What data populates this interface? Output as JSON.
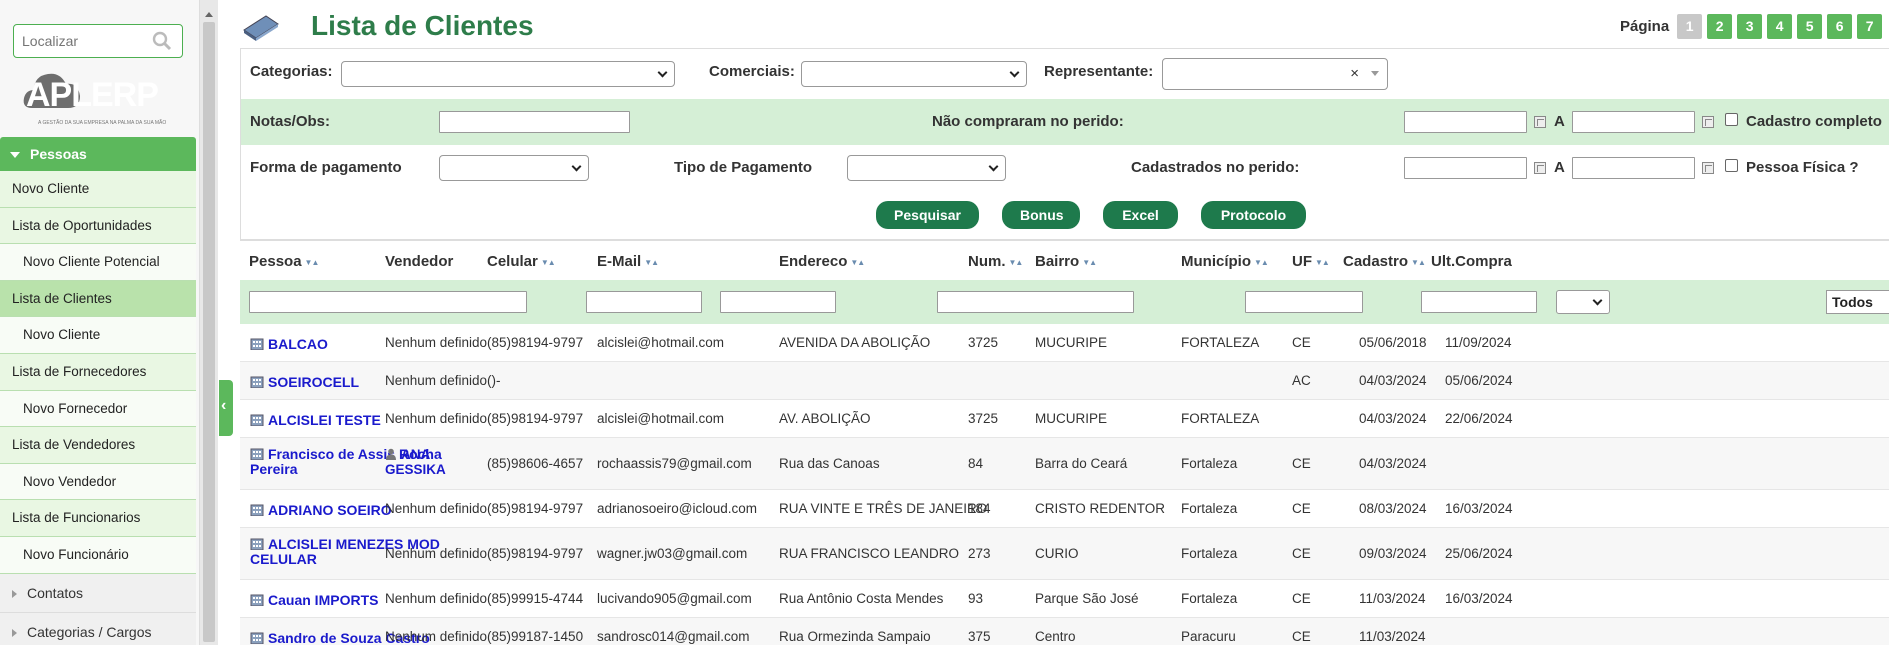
{
  "search": {
    "placeholder": "Localizar"
  },
  "logo": {
    "text": "APLERP",
    "tagline": "A GESTÃO DA SUA EMPRESA NA PALMA DA SUA MÃO"
  },
  "sidebar": {
    "section": "Pessoas",
    "items": [
      {
        "label": "Novo Cliente",
        "sub": false,
        "active": false
      },
      {
        "label": "Lista de Oportunidades",
        "sub": false,
        "active": false
      },
      {
        "label": "Novo Cliente Potencial",
        "sub": true,
        "active": false
      },
      {
        "label": "Lista de Clientes",
        "sub": false,
        "active": true
      },
      {
        "label": "Novo Cliente",
        "sub": true,
        "active": false
      },
      {
        "label": "Lista de Fornecedores",
        "sub": false,
        "active": false
      },
      {
        "label": "Novo Fornecedor",
        "sub": true,
        "active": false
      },
      {
        "label": "Lista de Vendedores",
        "sub": false,
        "active": false
      },
      {
        "label": "Novo Vendedor",
        "sub": true,
        "active": false
      },
      {
        "label": "Lista de Funcionarios",
        "sub": false,
        "active": false
      },
      {
        "label": "Novo Funcionário",
        "sub": true,
        "active": false
      }
    ],
    "collapsed": [
      "Contatos",
      "Categorias / Cargos"
    ]
  },
  "header": {
    "title": "Lista de Clientes",
    "pager_label": "Página",
    "pages": [
      "1",
      "2",
      "3",
      "4",
      "5",
      "6",
      "7"
    ],
    "current_page": "1"
  },
  "filters": {
    "categorias_label": "Categorias:",
    "comerciais_label": "Comerciais:",
    "representante_label": "Representante:",
    "representante_clear": "×",
    "notas_label": "Notas/Obs:",
    "nao_compraram_label": "Não compraram no perido:",
    "a_label": "A",
    "cadastro_completo_label": "Cadastro completo",
    "forma_pagamento_label": "Forma de pagamento",
    "tipo_pagamento_label": "Tipo de Pagamento",
    "cadastrados_label": "Cadastrados no perido:",
    "pessoa_fisica_label": "Pessoa Física ?"
  },
  "actions": {
    "pesquisar": "Pesquisar",
    "bonus": "Bonus",
    "excel": "Excel",
    "protocolo": "Protocolo"
  },
  "table": {
    "columns": [
      "Pessoa",
      "Vendedor",
      "Celular",
      "E-Mail",
      "Endereco",
      "Num.",
      "Bairro",
      "Município",
      "UF",
      "Cadastro",
      "Ult.Compra"
    ],
    "ult_compra_filter": "Todos",
    "rows": [
      {
        "pessoa": "BALCAO",
        "vendedor": "Nenhum definido",
        "vendedor_link": false,
        "celular": "(85)98194-9797",
        "email": "alcislei@hotmail.com",
        "endereco": "AVENIDA DA ABOLIÇÃO",
        "num": "3725",
        "bairro": "MUCURIPE",
        "municipio": "FORTALEZA",
        "uf": "CE",
        "cadastro": "05/06/2018",
        "ult_compra": "11/09/2024"
      },
      {
        "pessoa": "SOEIROCELL",
        "vendedor": "Nenhum definido",
        "vendedor_link": false,
        "celular": "()-",
        "email": "",
        "endereco": "",
        "num": "",
        "bairro": "",
        "municipio": "",
        "uf": "AC",
        "cadastro": "04/03/2024",
        "ult_compra": "05/06/2024"
      },
      {
        "pessoa": "ALCISLEI TESTE",
        "vendedor": "Nenhum definido",
        "vendedor_link": false,
        "celular": "(85)98194-9797",
        "email": "alcislei@hotmail.com",
        "endereco": "AV. ABOLIÇÃO",
        "num": "3725",
        "bairro": "MUCURIPE",
        "municipio": "FORTALEZA",
        "uf": "",
        "cadastro": "04/03/2024",
        "ult_compra": "22/06/2024"
      },
      {
        "pessoa": "Francisco de Assis Rocha Pereira",
        "vendedor": "ANA GESSIKA",
        "vendedor_link": true,
        "celular": "(85)98606-4657",
        "email": "rochaassis79@gmail.com",
        "endereco": "Rua das Canoas",
        "num": "84",
        "bairro": "Barra do Ceará",
        "municipio": "Fortaleza",
        "uf": "CE",
        "cadastro": "04/03/2024",
        "ult_compra": ""
      },
      {
        "pessoa": "ADRIANO SOEIRO",
        "vendedor": "Nenhum definido",
        "vendedor_link": false,
        "celular": "(85)98194-9797",
        "email": "adrianosoeiro@icloud.com",
        "endereco": "RUA VINTE E TRÊS DE JANEIRO",
        "num": "184",
        "bairro": "CRISTO REDENTOR",
        "municipio": "Fortaleza",
        "uf": "CE",
        "cadastro": "08/03/2024",
        "ult_compra": "16/03/2024"
      },
      {
        "pessoa": "ALCISLEI MENEZES MOD CELULAR",
        "vendedor": "Nenhum definido",
        "vendedor_link": false,
        "celular": "(85)98194-9797",
        "email": "wagner.jw03@gmail.com",
        "endereco": "RUA FRANCISCO LEANDRO",
        "num": "273",
        "bairro": "CURIO",
        "municipio": "Fortaleza",
        "uf": "CE",
        "cadastro": "09/03/2024",
        "ult_compra": "25/06/2024"
      },
      {
        "pessoa": "Cauan IMPORTS",
        "vendedor": "Nenhum definido",
        "vendedor_link": false,
        "celular": "(85)99915-4744",
        "email": "lucivando905@gmail.com",
        "endereco": "Rua Antônio Costa Mendes",
        "num": "93",
        "bairro": "Parque São José",
        "municipio": "Fortaleza",
        "uf": "CE",
        "cadastro": "11/03/2024",
        "ult_compra": "16/03/2024"
      },
      {
        "pessoa": "Sandro de Souza Castro",
        "vendedor": "Nenhum definido",
        "vendedor_link": false,
        "celular": "(85)99187-1450",
        "email": "sandrosc014@gmail.com",
        "endereco": "Rua Ormezinda Sampaio",
        "num": "375",
        "bairro": "Centro",
        "municipio": "Paracuru",
        "uf": "CE",
        "cadastro": "11/03/2024",
        "ult_compra": ""
      }
    ]
  },
  "colors": {
    "accent": "#5cb85c",
    "button": "#1e7a4c",
    "title": "#2e7d4a",
    "row_highlight": "#d5efd6",
    "link": "#1a1acc"
  }
}
